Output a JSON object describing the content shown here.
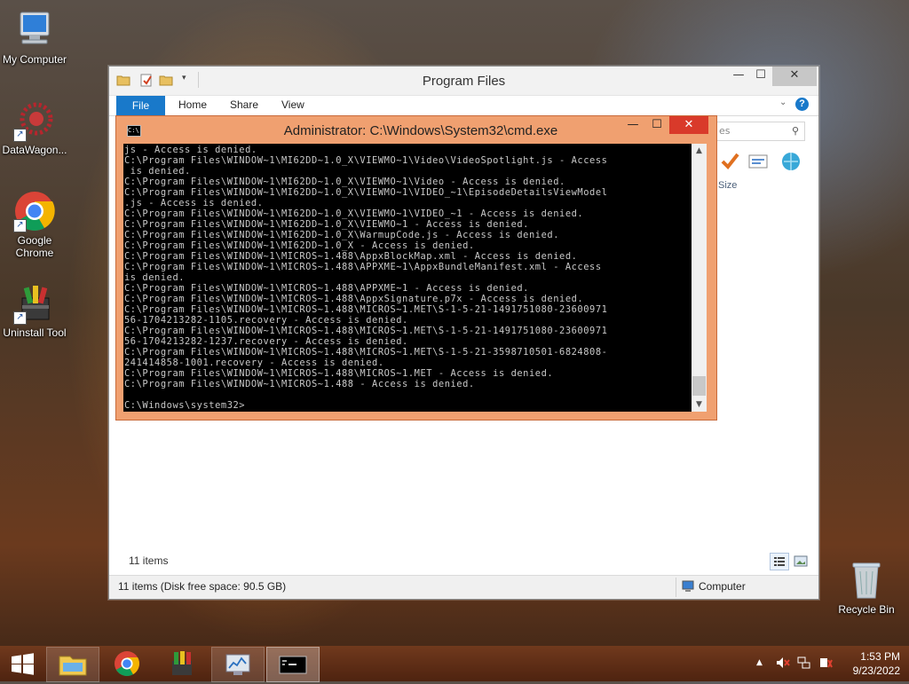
{
  "desktop": {
    "icons": [
      {
        "label": "My Computer"
      },
      {
        "label": "DataWagon..."
      },
      {
        "label": "Google Chrome"
      },
      {
        "label": "Uninstall Tool"
      }
    ],
    "recycle_bin": {
      "label": "Recycle Bin"
    }
  },
  "explorer": {
    "title": "Program Files",
    "tabs": {
      "file": "File",
      "home": "Home",
      "share": "Share",
      "view": "View"
    },
    "search_placeholder": "es",
    "column_size": "Size",
    "items_count": "11 items",
    "status_left": "11 items (Disk free space: 90.5 GB)",
    "status_right": "Computer"
  },
  "cmd": {
    "title": "Administrator: C:\\Windows\\System32\\cmd.exe",
    "icon_text": "C:\\",
    "output": "js - Access is denied.\nC:\\Program Files\\WINDOW~1\\MI62DD~1.0_X\\VIEWMO~1\\Video\\VideoSpotlight.js - Access\n is denied.\nC:\\Program Files\\WINDOW~1\\MI62DD~1.0_X\\VIEWMO~1\\Video - Access is denied.\nC:\\Program Files\\WINDOW~1\\MI62DD~1.0_X\\VIEWMO~1\\VIDEO_~1\\EpisodeDetailsViewModel\n.js - Access is denied.\nC:\\Program Files\\WINDOW~1\\MI62DD~1.0_X\\VIEWMO~1\\VIDEO_~1 - Access is denied.\nC:\\Program Files\\WINDOW~1\\MI62DD~1.0_X\\VIEWMO~1 - Access is denied.\nC:\\Program Files\\WINDOW~1\\MI62DD~1.0_X\\WarmupCode.js - Access is denied.\nC:\\Program Files\\WINDOW~1\\MI62DD~1.0_X - Access is denied.\nC:\\Program Files\\WINDOW~1\\MICROS~1.488\\AppxBlockMap.xml - Access is denied.\nC:\\Program Files\\WINDOW~1\\MICROS~1.488\\APPXME~1\\AppxBundleManifest.xml - Access\nis denied.\nC:\\Program Files\\WINDOW~1\\MICROS~1.488\\APPXME~1 - Access is denied.\nC:\\Program Files\\WINDOW~1\\MICROS~1.488\\AppxSignature.p7x - Access is denied.\nC:\\Program Files\\WINDOW~1\\MICROS~1.488\\MICROS~1.MET\\S-1-5-21-1491751080-23600971\n56-1704213282-1105.recovery - Access is denied.\nC:\\Program Files\\WINDOW~1\\MICROS~1.488\\MICROS~1.MET\\S-1-5-21-1491751080-23600971\n56-1704213282-1237.recovery - Access is denied.\nC:\\Program Files\\WINDOW~1\\MICROS~1.488\\MICROS~1.MET\\S-1-5-21-3598710501-6824808-\n241414858-1001.recovery - Access is denied.\nC:\\Program Files\\WINDOW~1\\MICROS~1.488\\MICROS~1.MET - Access is denied.\nC:\\Program Files\\WINDOW~1\\MICROS~1.488 - Access is denied.\n\nC:\\Windows\\system32>"
  },
  "taskbar": {
    "time": "1:53 PM",
    "date": "9/23/2022"
  }
}
